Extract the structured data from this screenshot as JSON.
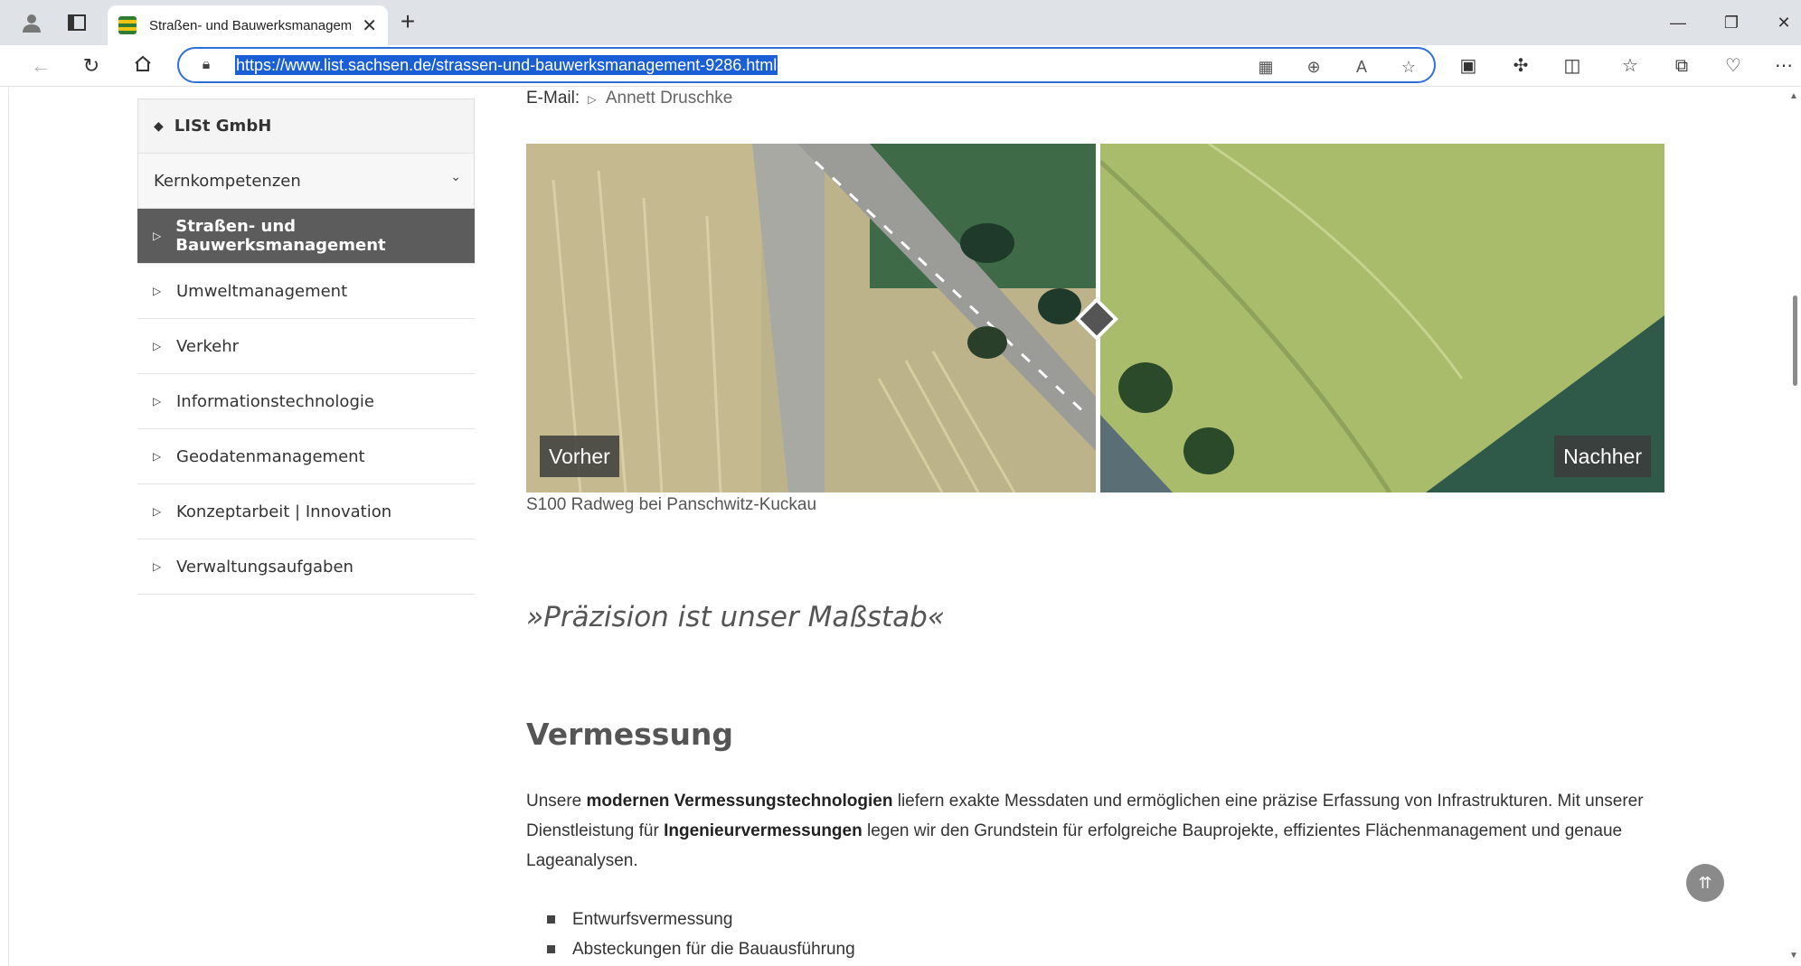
{
  "browser": {
    "tab_title": "Straßen- und Bauwerksmanagem",
    "url": "https://www.list.sachsen.de/strassen-und-bauwerksmanagement-9286.html",
    "accent": "#1a5fd6"
  },
  "sidebar": {
    "org": "LISt GmbH",
    "section": "Kernkompetenzen",
    "items": [
      {
        "label": "Straßen- und Bauwerksmanagement",
        "active": true
      },
      {
        "label": "Umweltmanagement"
      },
      {
        "label": "Verkehr"
      },
      {
        "label": "Informationstechnologie"
      },
      {
        "label": "Geodatenmanagement"
      },
      {
        "label": "Konzeptarbeit | Innovation"
      },
      {
        "label": "Verwaltungsaufgaben"
      }
    ],
    "active_color": "#5c5c5c"
  },
  "contact": {
    "email_label": "E-Mail:",
    "email_name": "Annett Druschke"
  },
  "compare": {
    "before_label": "Vorher",
    "after_label": "Nachher",
    "caption": "S100 Radweg bei Panschwitz-Kuckau"
  },
  "content": {
    "quote": "»Präzision ist unser Maßstab«",
    "heading": "Vermessung",
    "para_1": "Unsere ",
    "para_b1": "modernen Vermessungstechnologien",
    "para_2": " liefern exakte Messdaten und ermöglichen eine präzise Erfassung von Infrastrukturen. Mit unserer Dienstleistung für ",
    "para_b2": "Ingenieurvermessungen",
    "para_3": " legen wir den Grundstein für erfolgreiche Bauprojekte, effizientes Flächenmanagement und genaue Lageanalysen.",
    "bullets": [
      "Entwurfsvermessung",
      "Absteckungen für die Bauausführung"
    ]
  }
}
